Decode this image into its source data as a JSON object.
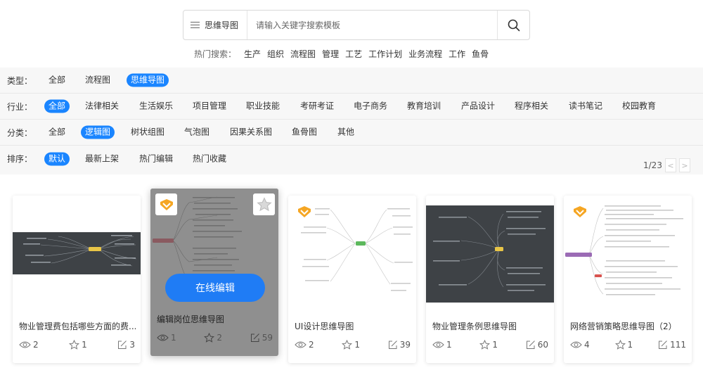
{
  "search": {
    "type_label": "思维导图",
    "placeholder": "请输入关键字搜索模板"
  },
  "hot": {
    "label": "热门搜索：",
    "items": [
      "生产",
      "组织",
      "流程图",
      "管理",
      "工艺",
      "工作计划",
      "业务流程",
      "工作",
      "鱼骨"
    ]
  },
  "filters": {
    "type": {
      "label": "类型：",
      "options": [
        "全部",
        "流程图",
        "思维导图"
      ],
      "active": "思维导图"
    },
    "industry": {
      "label": "行业：",
      "options": [
        "全部",
        "法律相关",
        "生活娱乐",
        "项目管理",
        "职业技能",
        "考研考证",
        "电子商务",
        "教育培训",
        "产品设计",
        "程序相关",
        "读书笔记",
        "校园教育"
      ],
      "active": "全部"
    },
    "category": {
      "label": "分类：",
      "options": [
        "全部",
        "逻辑图",
        "树状组图",
        "气泡图",
        "因果关系图",
        "鱼骨图",
        "其他"
      ],
      "active": "逻辑图"
    },
    "sort": {
      "label": "排序：",
      "options": [
        "默认",
        "最新上架",
        "热门编辑",
        "热门收藏"
      ],
      "active": "默认"
    }
  },
  "pager": {
    "text": "1/23",
    "prev": "<",
    "next": ">"
  },
  "edit_online_label": "在线编辑",
  "cards": [
    {
      "title": "物业管理费包括哪些方面的费...",
      "views": "2",
      "stars": "1",
      "edits": "3",
      "theme": "dark",
      "badge": false
    },
    {
      "title": "编辑岗位思维导图",
      "views": "1",
      "stars": "2",
      "edits": "59",
      "theme": "hover",
      "badge": true
    },
    {
      "title": "UI设计思维导图",
      "views": "2",
      "stars": "1",
      "edits": "39",
      "theme": "light",
      "badge": true
    },
    {
      "title": "物业管理条例思维导图",
      "views": "1",
      "stars": "1",
      "edits": "60",
      "theme": "dark",
      "badge": false
    },
    {
      "title": "网络营销策略思维导图（2）",
      "views": "4",
      "stars": "1",
      "edits": "111",
      "theme": "light",
      "badge": true
    }
  ],
  "colors": {
    "accent": "#1a85ff",
    "badge": "#f5a623",
    "dark_thumb": "#3e4246"
  }
}
